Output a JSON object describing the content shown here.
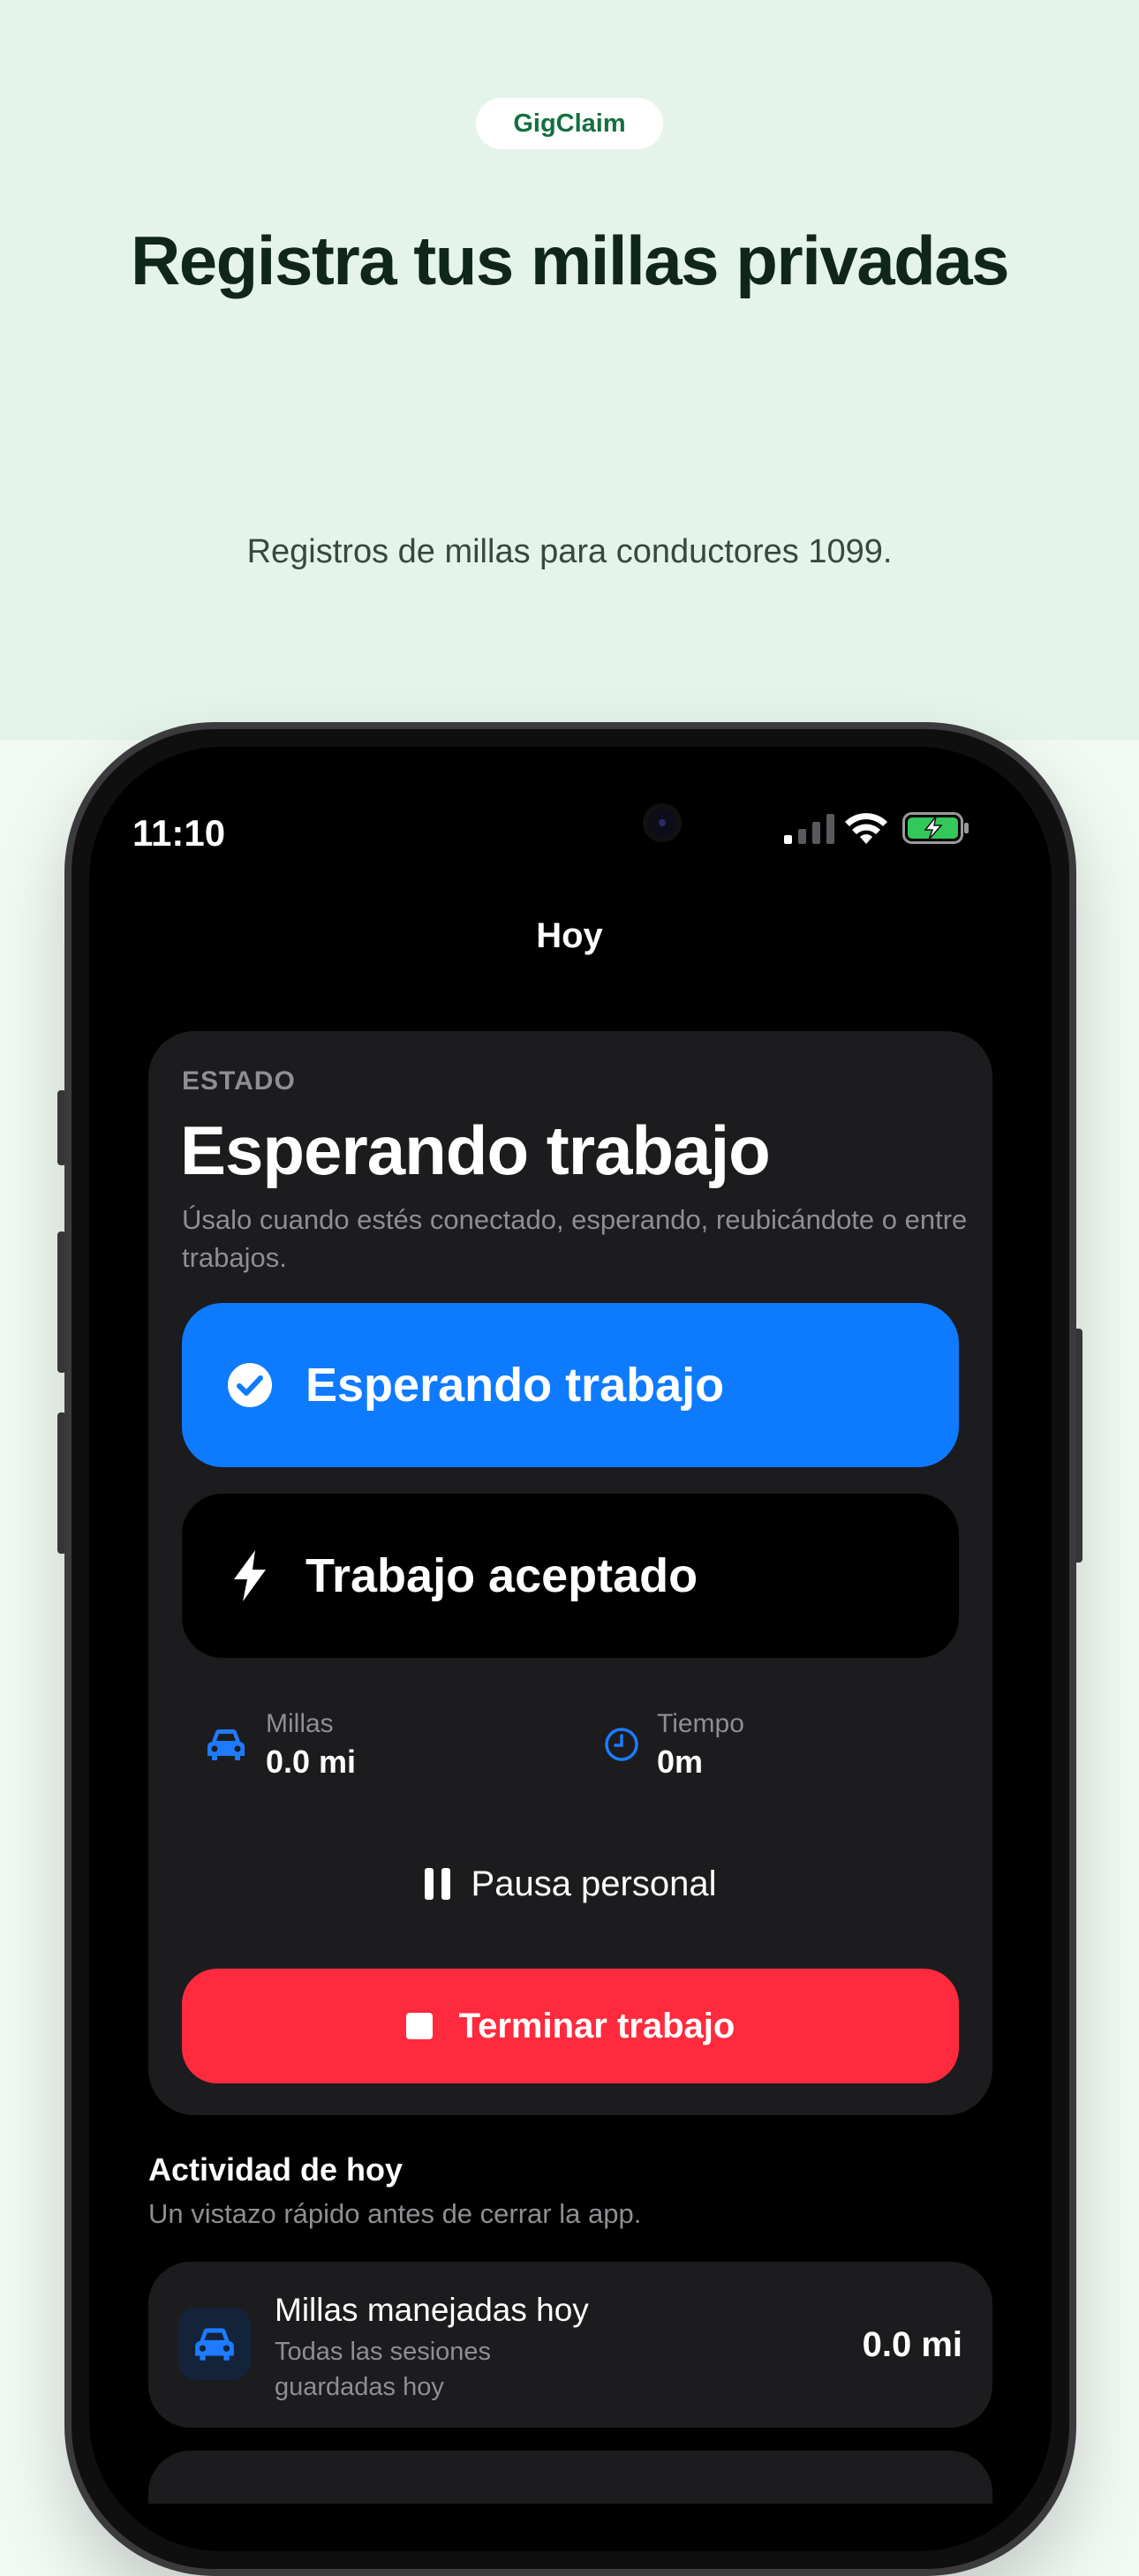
{
  "hero": {
    "badge": "GigClaim",
    "headline": "Registra tus millas privadas",
    "subline": "Registros de millas para conductores 1099."
  },
  "status_bar": {
    "time": "11:10",
    "battery": "charging"
  },
  "nav": {
    "title": "Hoy"
  },
  "status_card": {
    "eyebrow": "ESTADO",
    "status": "Esperando trabajo",
    "description": "Úsalo cuando estés conectado, esperando, reubicándote o entre trabajos.",
    "modes": [
      {
        "label": "Esperando trabajo",
        "icon": "checkmark-circle-icon",
        "selected": true
      },
      {
        "label": "Trabajo aceptado",
        "icon": "bolt-icon",
        "selected": false
      }
    ],
    "metrics": [
      {
        "label": "Millas",
        "value": "0.0 mi",
        "icon": "car-icon"
      },
      {
        "label": "Tiempo",
        "value": "0m",
        "icon": "clock-icon"
      }
    ],
    "pause_label": "Pausa personal",
    "end_label": "Terminar trabajo"
  },
  "activity": {
    "title": "Actividad de hoy",
    "subtitle": "Un vistazo rápido antes de cerrar la app.",
    "items": [
      {
        "title": "Millas manejadas hoy",
        "subtitle": "Todas las sesiones guardadas hoy",
        "value": "0.0 mi",
        "icon": "car-icon"
      }
    ]
  },
  "colors": {
    "accent_blue": "#0e7bff",
    "danger_red": "#ff2a3d",
    "brand_green": "#13703f",
    "hero_bg": "#e4f4ea"
  }
}
